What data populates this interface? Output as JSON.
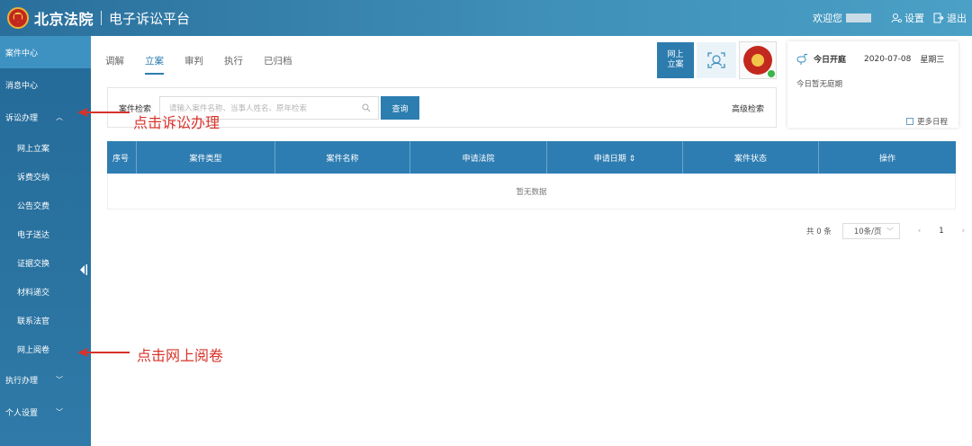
{
  "header": {
    "court_name": "北京法院",
    "platform_name": "电子诉讼平台",
    "welcome": "欢迎您",
    "settings_label": "设置",
    "logout_label": "退出"
  },
  "sidebar": {
    "items": [
      {
        "label": "案件中心"
      },
      {
        "label": "消息中心"
      },
      {
        "label": "诉讼办理"
      },
      {
        "label": "执行办理"
      },
      {
        "label": "个人设置"
      }
    ],
    "sub_items": [
      {
        "label": "网上立案"
      },
      {
        "label": "诉费交纳"
      },
      {
        "label": "公告交费"
      },
      {
        "label": "电子送达"
      },
      {
        "label": "证据交换"
      },
      {
        "label": "材料递交"
      },
      {
        "label": "联系法官"
      },
      {
        "label": "网上阅卷"
      }
    ]
  },
  "tabs": [
    {
      "label": "调解"
    },
    {
      "label": "立案"
    },
    {
      "label": "审判"
    },
    {
      "label": "执行"
    },
    {
      "label": "已归档"
    }
  ],
  "online_filing": {
    "line1": "网上",
    "line2": "立案"
  },
  "calendar": {
    "title": "今日开庭",
    "date": "2020-07-08",
    "weekday": "星期三",
    "empty": "今日暂无庭期",
    "more": "更多日程"
  },
  "search": {
    "label": "案件检索",
    "placeholder": "请输入案件名称、当事人姓名、原年检索",
    "button": "查询",
    "advanced": "高级检索"
  },
  "table": {
    "columns": [
      "序号",
      "案件类型",
      "案件名称",
      "申请法院",
      "申请日期 ⇕",
      "案件状态",
      "操作"
    ],
    "empty": "暂无数据"
  },
  "pagination": {
    "total": "共 0 条",
    "page_size": "10条/页",
    "current_page": "1"
  },
  "annotations": {
    "litigation": "点击诉讼办理",
    "read_files": "点击网上阅卷"
  },
  "colors": {
    "primary": "#2c7eb0",
    "sidebar": "#2a72a0",
    "annotation": "#d7322a"
  }
}
